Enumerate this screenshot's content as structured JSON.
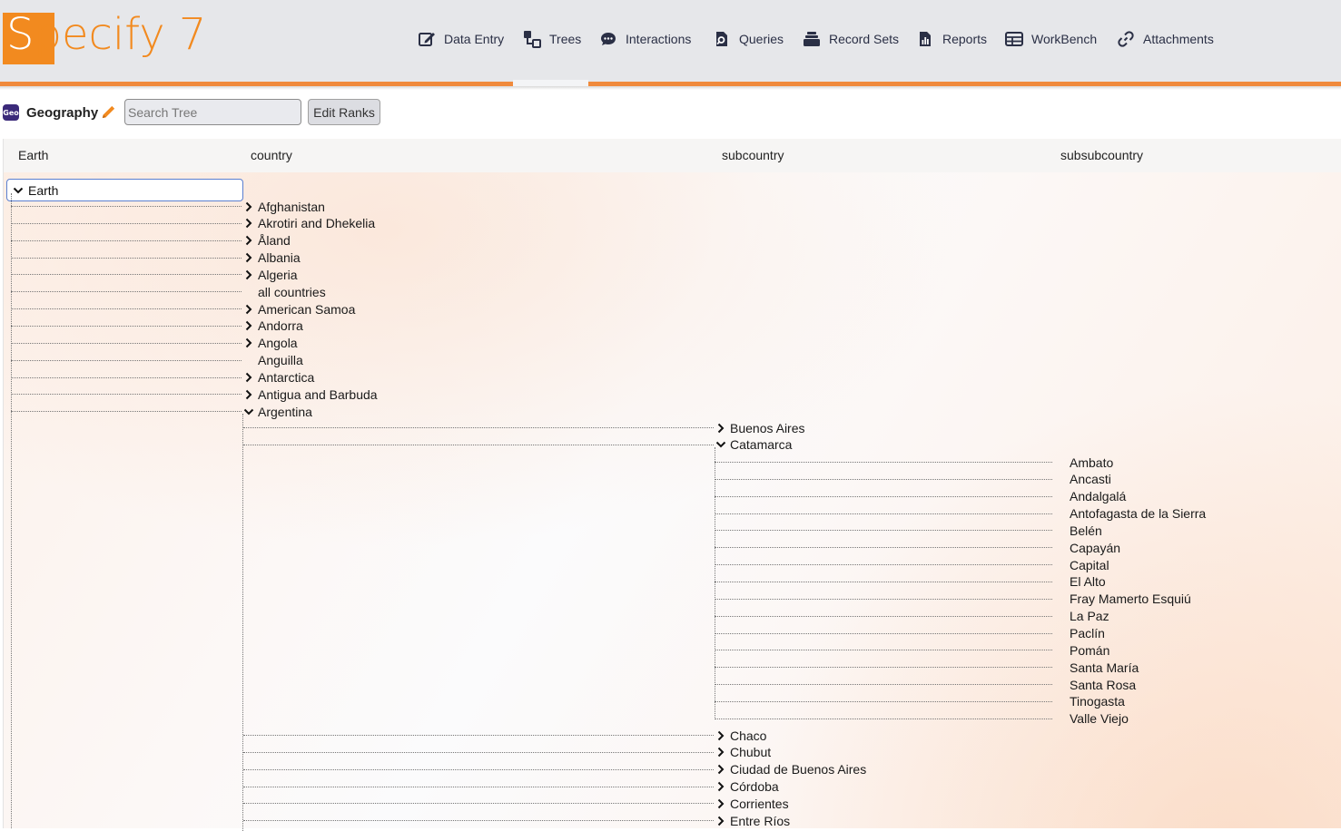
{
  "app": {
    "logo_text": "Specify 7",
    "accent_color": "#f08a3c"
  },
  "nav": {
    "items": [
      {
        "label": "Data Entry",
        "icon": "pencil-square-icon"
      },
      {
        "label": "Trees",
        "icon": "tree-nodes-icon"
      },
      {
        "label": "Interactions",
        "icon": "chat-bubble-icon"
      },
      {
        "label": "Queries",
        "icon": "search-document-icon"
      },
      {
        "label": "Record Sets",
        "icon": "stack-icon"
      },
      {
        "label": "Reports",
        "icon": "report-icon"
      },
      {
        "label": "WorkBench",
        "icon": "table-icon"
      },
      {
        "label": "Attachments",
        "icon": "link-icon"
      }
    ],
    "active": "Trees"
  },
  "toolbar": {
    "badge": "Geo",
    "tree_name": "Geography",
    "search_placeholder": "Search Tree",
    "edit_ranks_label": "Edit Ranks"
  },
  "ranks": [
    "Earth",
    "country",
    "subcountry",
    "subsubcountry"
  ],
  "tree": {
    "root": {
      "label": "Earth",
      "expanded": true
    },
    "countries": [
      {
        "label": "Afghanistan",
        "has_children": true
      },
      {
        "label": "Akrotiri and Dhekelia",
        "has_children": true
      },
      {
        "label": "Åland",
        "has_children": true
      },
      {
        "label": "Albania",
        "has_children": true
      },
      {
        "label": "Algeria",
        "has_children": true
      },
      {
        "label": "all countries",
        "has_children": false
      },
      {
        "label": "American Samoa",
        "has_children": true
      },
      {
        "label": "Andorra",
        "has_children": true
      },
      {
        "label": "Angola",
        "has_children": true
      },
      {
        "label": "Anguilla",
        "has_children": false
      },
      {
        "label": "Antarctica",
        "has_children": true
      },
      {
        "label": "Antigua and Barbuda",
        "has_children": true
      },
      {
        "label": "Argentina",
        "has_children": true,
        "expanded": true
      }
    ],
    "subcountries_top": [
      {
        "label": "Buenos Aires",
        "has_children": true
      },
      {
        "label": "Catamarca",
        "has_children": true,
        "expanded": true
      }
    ],
    "subsubcountries": [
      "Ambato",
      "Ancasti",
      "Andalgalá",
      "Antofagasta de la Sierra",
      "Belén",
      "Capayán",
      "Capital",
      "El Alto",
      "Fray Mamerto Esquiú",
      "La Paz",
      "Paclín",
      "Pomán",
      "Santa María",
      "Santa Rosa",
      "Tinogasta",
      "Valle Viejo"
    ],
    "subcountries_bottom": [
      {
        "label": "Chaco",
        "has_children": true
      },
      {
        "label": "Chubut",
        "has_children": true
      },
      {
        "label": "Ciudad de Buenos Aires",
        "has_children": true
      },
      {
        "label": "Córdoba",
        "has_children": true
      },
      {
        "label": "Corrientes",
        "has_children": true
      },
      {
        "label": "Entre Ríos",
        "has_children": true
      }
    ]
  }
}
